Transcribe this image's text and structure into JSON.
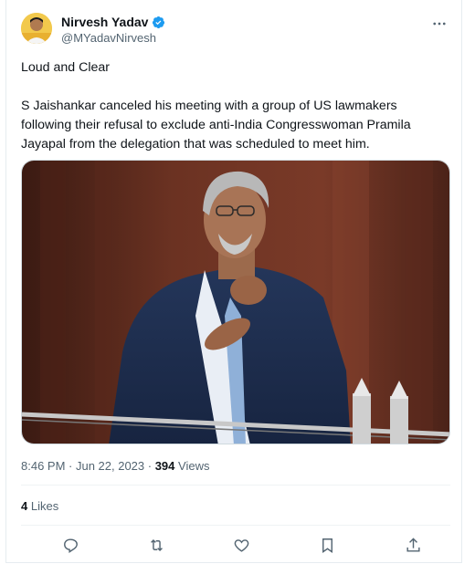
{
  "author": {
    "display_name": "Nirvesh Yadav",
    "handle": "@MYadavNirvesh",
    "verified_color": "#1d9bf0"
  },
  "tweet": {
    "line1": "Loud and Clear",
    "line2": "S Jaishankar canceled his meeting with a group of US lawmakers following their refusal to exclude anti-India Congresswoman Pramila Jayapal from the delegation that was scheduled to meet him."
  },
  "meta": {
    "time": "8:46 PM · Jun 22, 2023 · ",
    "views_count": "394",
    "views_label": " Views"
  },
  "stats": {
    "likes_count": "4",
    "likes_label": " Likes"
  },
  "icons": {
    "more": "more-icon",
    "reply": "reply-icon",
    "retweet": "retweet-icon",
    "like": "heart-icon",
    "bookmark": "bookmark-icon",
    "share": "share-icon"
  },
  "colors": {
    "text": "#0f1419",
    "secondary": "#536471",
    "accent": "#1d9bf0"
  }
}
